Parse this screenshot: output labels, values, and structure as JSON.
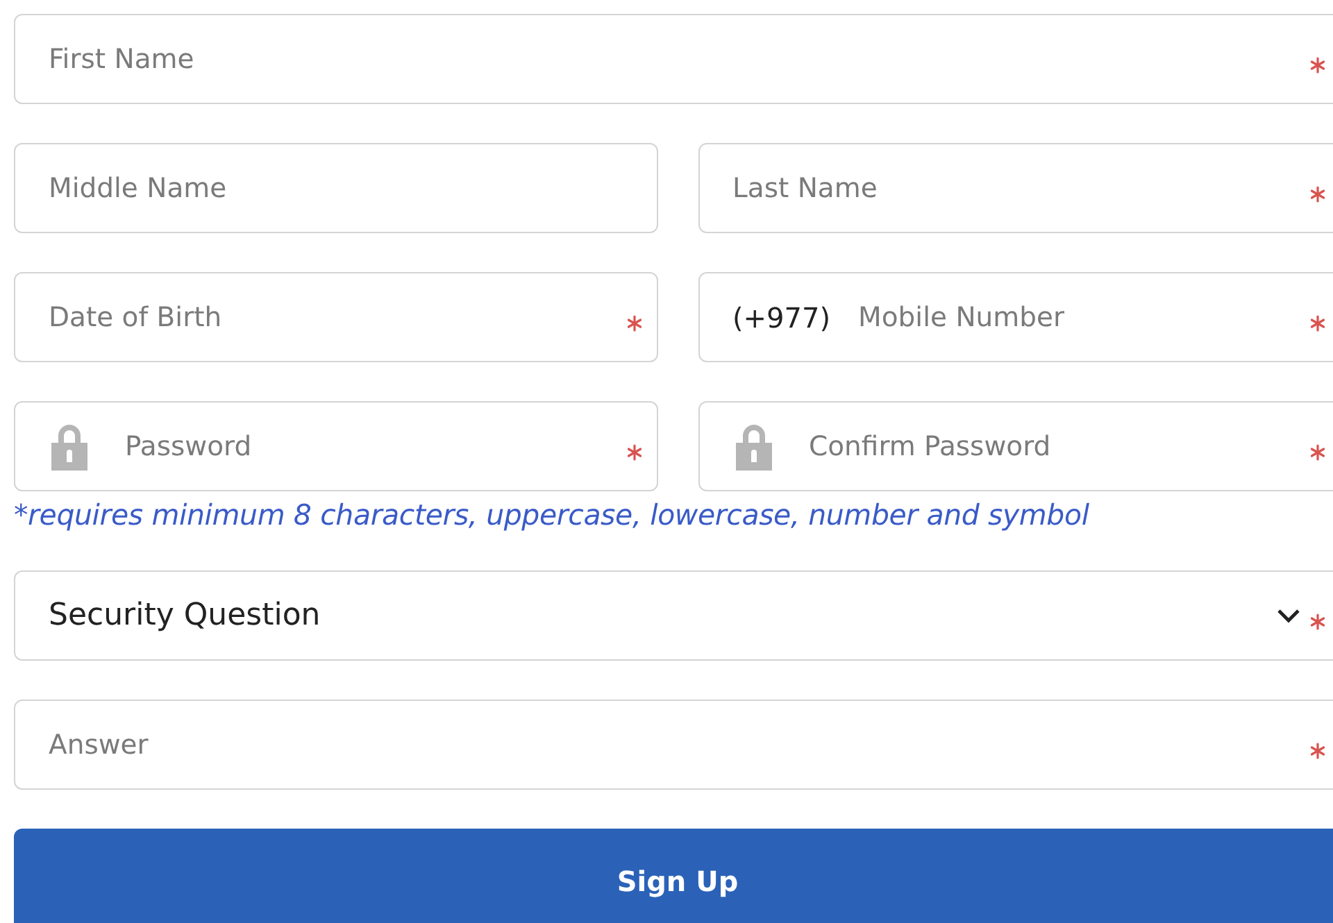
{
  "rows": [
    [
      {
        "kind": "text",
        "placeholder": "First Name",
        "required": true
      }
    ],
    [
      {
        "kind": "text",
        "placeholder": "Middle Name",
        "required": false
      },
      {
        "kind": "text",
        "placeholder": "Last Name",
        "required": true
      }
    ],
    [
      {
        "kind": "text",
        "placeholder": "Date of Birth",
        "required": true
      },
      {
        "kind": "phone",
        "prefix": "(+977)",
        "placeholder": "Mobile Number",
        "required": true
      }
    ],
    [
      {
        "kind": "password",
        "placeholder": "Password",
        "required": true
      },
      {
        "kind": "password",
        "placeholder": "Confirm Password",
        "required": true
      }
    ]
  ],
  "password_hint": "*requires minimum 8 characters, uppercase, lowercase, number and symbol",
  "security_question": {
    "kind": "select",
    "value": "Security Question",
    "required": true
  },
  "answer": {
    "kind": "text",
    "placeholder": "Answer",
    "required": true
  },
  "submit": {
    "label": "Sign Up"
  }
}
